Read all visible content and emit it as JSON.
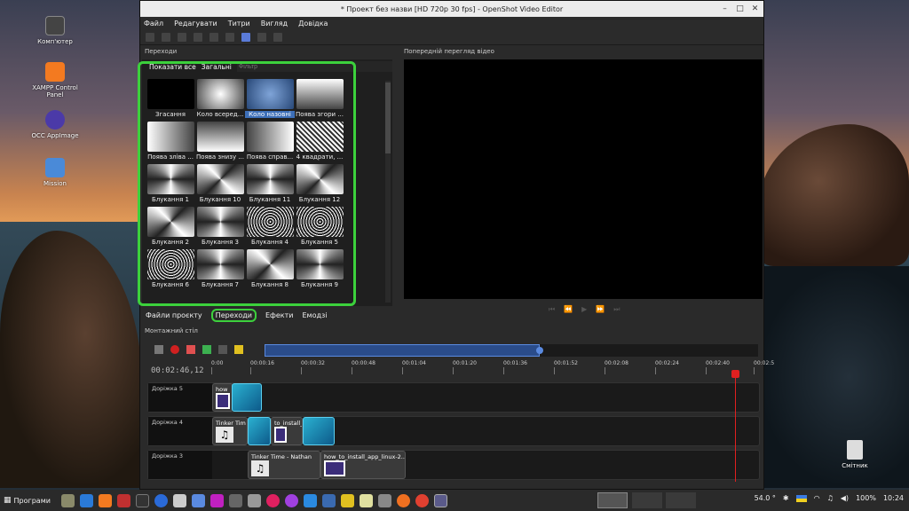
{
  "desktop": {
    "icons": [
      {
        "label": "Комп'ютер"
      },
      {
        "label": "XAMPP Control Panel"
      },
      {
        "label": "OCC AppImage"
      },
      {
        "label": "Mission"
      }
    ],
    "trash": "Смітник"
  },
  "window": {
    "title": "* Проект без назви [HD 720p 30 fps] - OpenShot Video Editor",
    "menu": [
      "Файл",
      "Редагувати",
      "Титри",
      "Вигляд",
      "Довідка"
    ]
  },
  "transitions_panel": {
    "header": "Переходи",
    "filter_all": "Показати все",
    "filter_common": "Загальні",
    "filter_placeholder": "Фільтр",
    "items": [
      {
        "label": "Згасання",
        "style": "t-black"
      },
      {
        "label": "Коло всеред...",
        "style": "t-radial"
      },
      {
        "label": "Коло назовні",
        "style": "t-radial2",
        "selected": true
      },
      {
        "label": "Поява згори ...",
        "style": "t-vgrad"
      },
      {
        "label": "Поява зліва ...",
        "style": "t-hgrad"
      },
      {
        "label": "Поява знизу ...",
        "style": "t-vgrad2"
      },
      {
        "label": "Поява справ...",
        "style": "t-hgrad2"
      },
      {
        "label": "4 квадрати, ...",
        "style": "t-stripe"
      },
      {
        "label": "Блукання 1",
        "style": "t-blink"
      },
      {
        "label": "Блукання 10",
        "style": "t-blink2"
      },
      {
        "label": "Блукання 11",
        "style": "t-blink"
      },
      {
        "label": "Блукання 12",
        "style": "t-blink2"
      },
      {
        "label": "Блукання 2",
        "style": "t-blink2"
      },
      {
        "label": "Блукання 3",
        "style": "t-blink"
      },
      {
        "label": "Блукання 4",
        "style": "t-noise"
      },
      {
        "label": "Блукання 5",
        "style": "t-noise"
      },
      {
        "label": "Блукання 6",
        "style": "t-noise"
      },
      {
        "label": "Блукання 7",
        "style": "t-blink"
      },
      {
        "label": "Блукання 8",
        "style": "t-blink2"
      },
      {
        "label": "Блукання 9",
        "style": "t-blink"
      }
    ]
  },
  "preview": {
    "header": "Попередній перегляд відео"
  },
  "tabs": [
    "Файли проєкту",
    "Переходи",
    "Ефекти",
    "Емодзі"
  ],
  "timeline": {
    "header": "Монтажний стіл",
    "time": "00:02:46,12",
    "ticks": [
      "0:00",
      "00:00:16",
      "00:00:32",
      "00:00:48",
      "00:01:04",
      "00:01:20",
      "00:01:36",
      "00:01:52",
      "00:02:08",
      "00:02:24",
      "00:02:40",
      "00:02:5"
    ],
    "tracks": [
      {
        "name": "Доріжка 5"
      },
      {
        "name": "Доріжка 4"
      },
      {
        "name": "Доріжка 3"
      }
    ],
    "clips": {
      "t5_clip": "how",
      "t4_clip1": "Tinker Tim",
      "t4_clip2": "to_install_a",
      "t3_clip1": "Tinker Time - Nathan",
      "t3_clip2": "how_to_install_app_linux-2..."
    }
  },
  "taskbar": {
    "start": "Програми",
    "temp": "54.0 °",
    "battery": "100%",
    "clock": "10:24"
  }
}
